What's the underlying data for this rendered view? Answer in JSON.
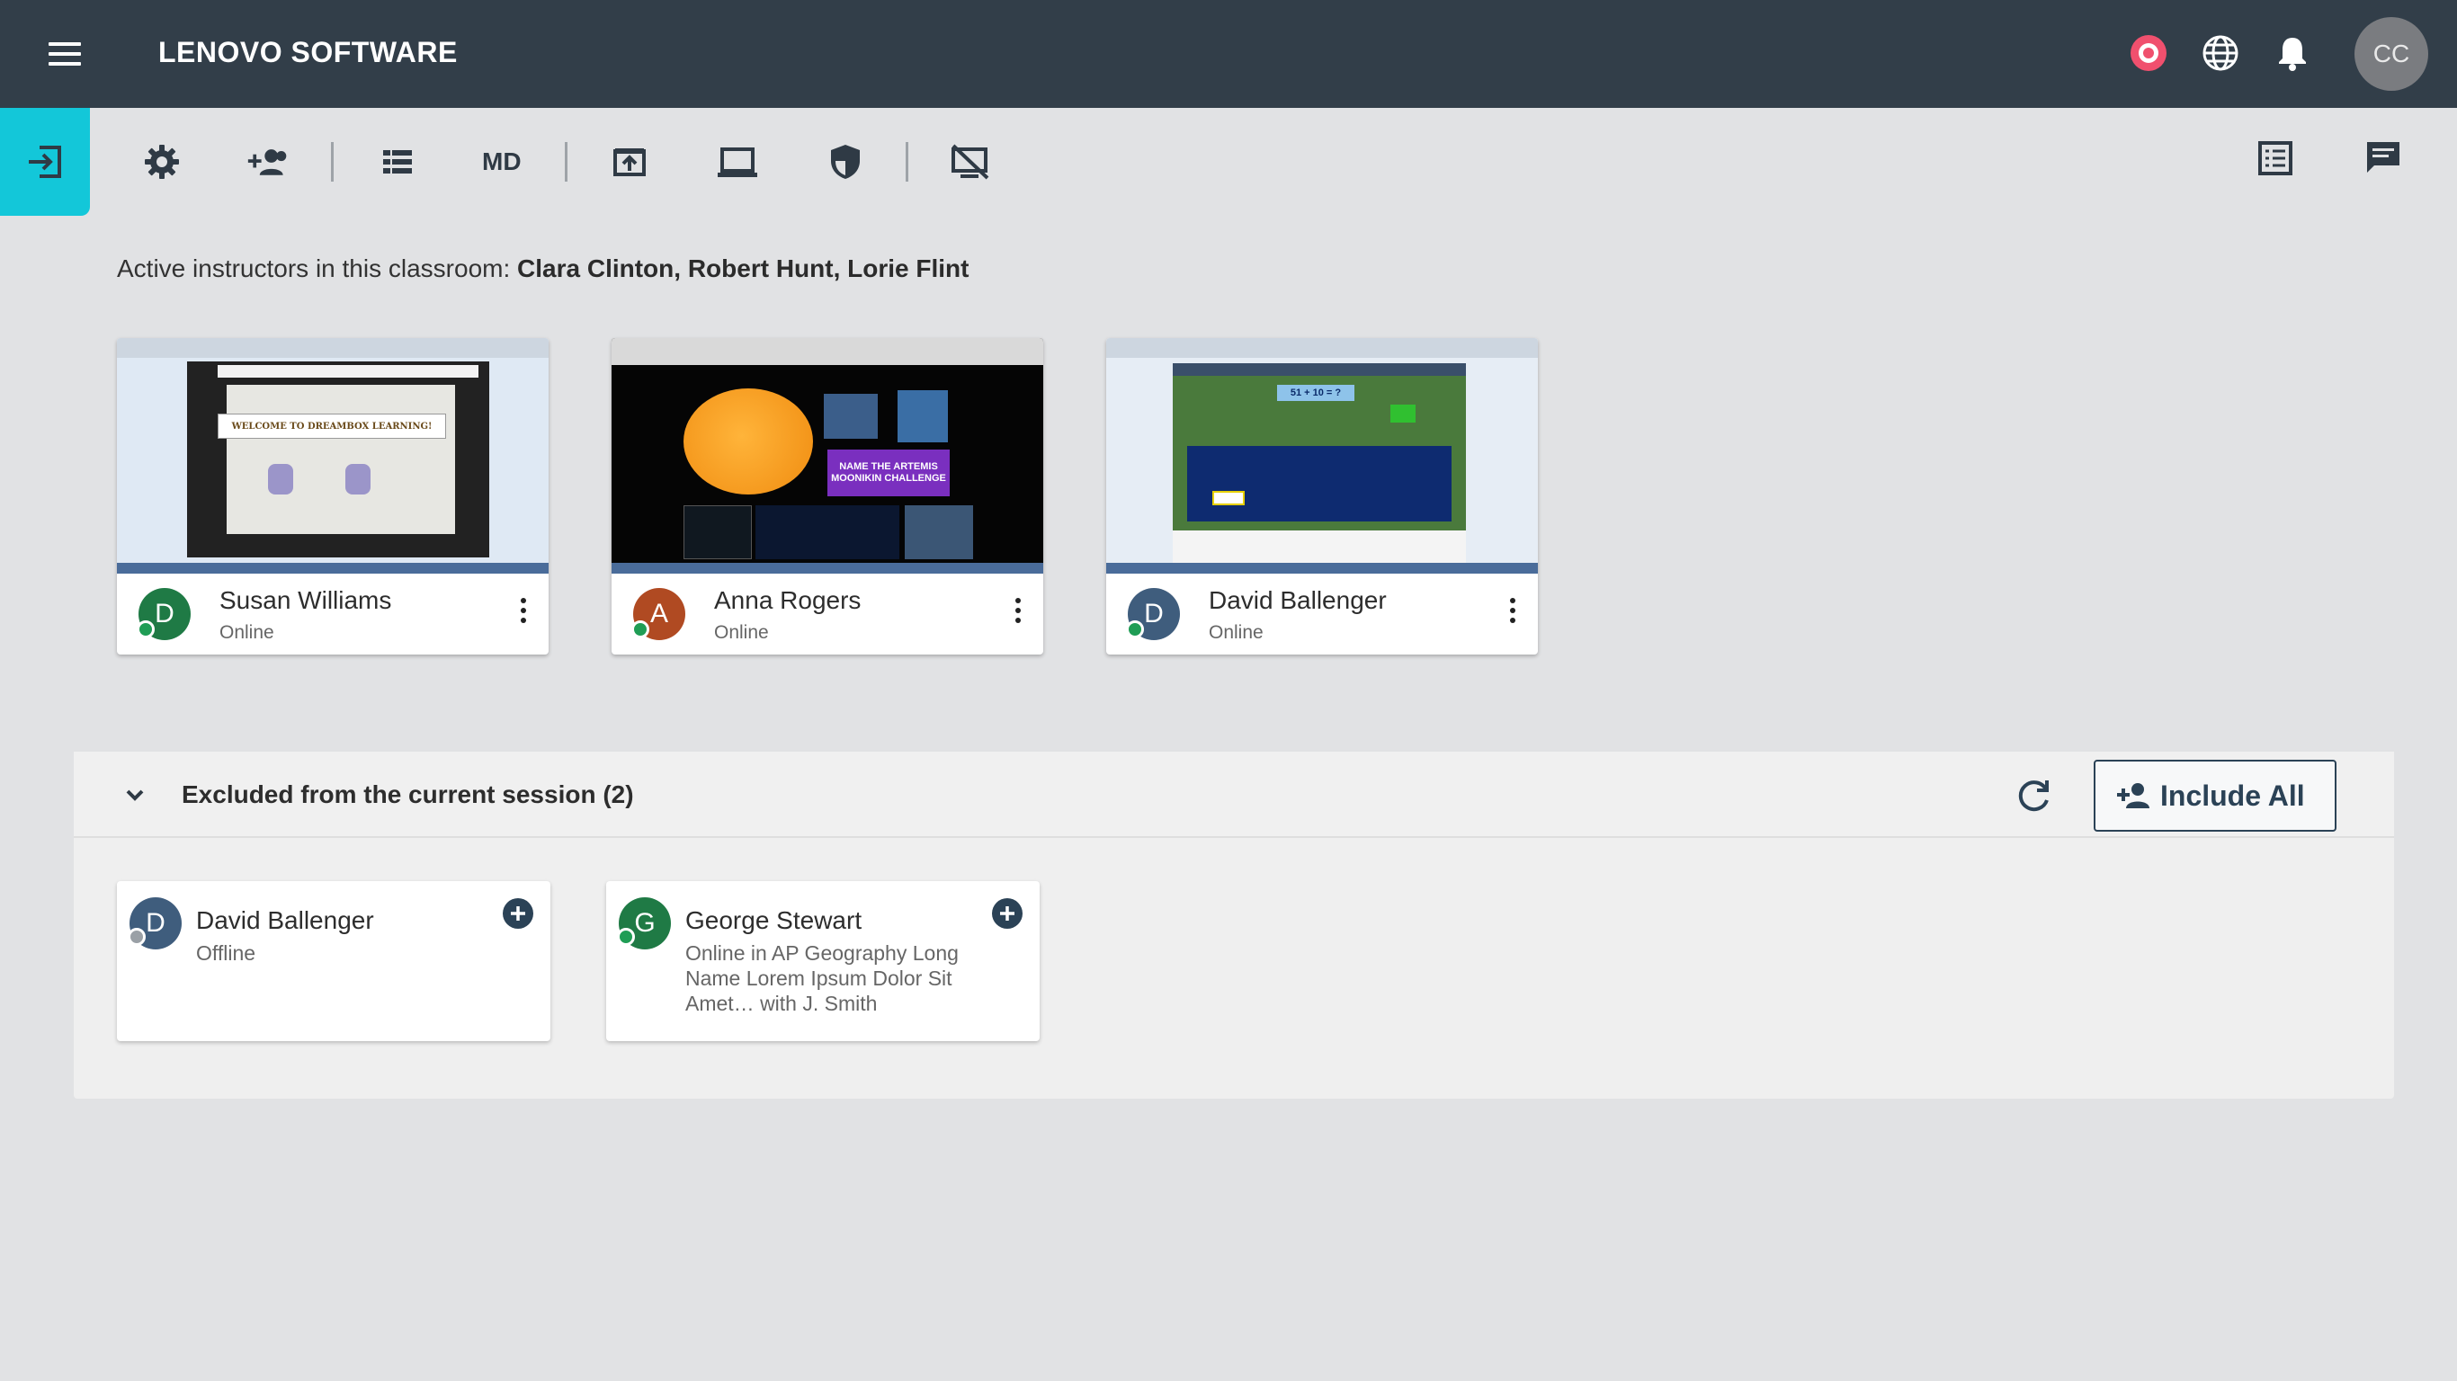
{
  "header": {
    "title": "LENOVO SOFTWARE",
    "menu_icon": "hamburger-menu-icon",
    "record_icon": "record-icon",
    "globe_icon": "globe-icon",
    "bell_icon": "bell-icon",
    "user_initials": "CC"
  },
  "toolbar": {
    "exit_icon": "exit-session-icon",
    "md_label": "MD",
    "icons": [
      "settings-icon",
      "add-group-icon",
      "list-view-icon",
      "share-screen-icon",
      "laptop-icon",
      "shield-icon",
      "screen-off-icon",
      "view-list-icon",
      "chat-icon"
    ]
  },
  "instructors": {
    "prefix": "Active instructors in this classroom:",
    "names": "Clara Clinton, Robert Hunt, Lorie Flint"
  },
  "students": [
    {
      "initial": "D",
      "name": "Susan Williams",
      "status": "Online",
      "avatar_color": "#1f7a45",
      "screen_text": "WELCOME TO DREAMBOX LEARNING!"
    },
    {
      "initial": "A",
      "name": "Anna Rogers",
      "status": "Online",
      "avatar_color": "#b04a22",
      "screen_text": "NAME THE ARTEMIS MOONIKIN CHALLENGE"
    },
    {
      "initial": "D",
      "name": "David Ballenger",
      "status": "Online",
      "avatar_color": "#3f5d7d",
      "screen_text": "51 + 10 = ?"
    }
  ],
  "excluded": {
    "title": "Excluded from the current session (2)",
    "include_all_label": "Include All",
    "items": [
      {
        "initial": "D",
        "name": "David Ballenger",
        "status": "Offline",
        "avatar_color": "#3f5d7d",
        "dot_color": "#9aa0a6"
      },
      {
        "initial": "G",
        "name": "George Stewart",
        "status": "Online in AP Geography Long Name Lorem Ipsum Dolor Sit Amet… with J. Smith",
        "avatar_color": "#1f7a45",
        "dot_color": "#1f9d55"
      }
    ]
  },
  "colors": {
    "header_bg": "#323e49",
    "accent": "#13c7d9",
    "online": "#1f9d55",
    "offline": "#9aa0a6",
    "record": "#f0506e"
  }
}
